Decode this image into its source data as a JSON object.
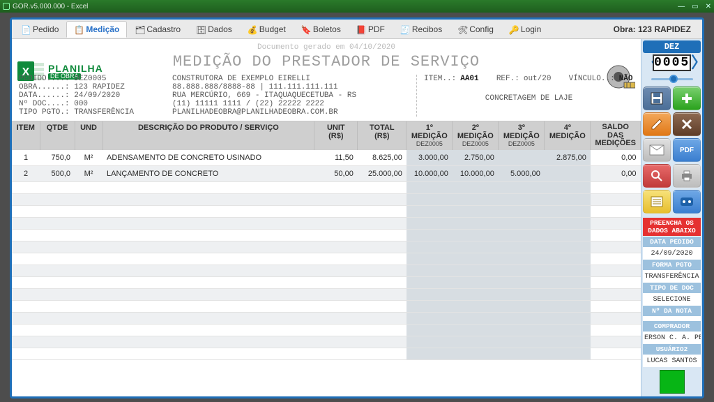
{
  "window": {
    "title": "GOR.v5.000.000 - Excel"
  },
  "menubar": {
    "items": [
      {
        "label": "Pedido"
      },
      {
        "label": "Medição"
      },
      {
        "label": "Cadastro"
      },
      {
        "label": "Dados"
      },
      {
        "label": "Budget"
      },
      {
        "label": "Boletos"
      },
      {
        "label": "PDF"
      },
      {
        "label": "Recibos"
      },
      {
        "label": "Config"
      },
      {
        "label": "Login"
      }
    ],
    "obra": "Obra: 123 RAPIDEZ"
  },
  "doc": {
    "generated": "Documento gerado em 04/10/2020",
    "title": "MEDIÇÃO DO PRESTADOR DE SERVIÇO",
    "brand1": "PLANILHA",
    "brand2": "DE OBRA",
    "left": "PEDIDO....: DEZ0005\nOBRA......: 123 RAPIDEZ\nDATA......: 24/09/2020\nNº DOC....: 000\nTIPO PGTO.: TRANSFERÊNCIA",
    "mid": "CONSTRUTORA DE EXEMPLO EIRELLI\n88.888.888/8888-88 | 111.111.111.111\nRUA MERCÚRIO, 669 - ITAQUAQUECETUBA - RS\n(11) 11111 1111 / (22) 22222 2222\nPLANILHADEOBRA@PLANILHADEOBRA.COM.BR",
    "right": {
      "item_l": "ITEM..:",
      "item_v": "AA01",
      "ref_l": "REF.:",
      "ref_v": "out/20",
      "vinc_l": "VÍNCULO..:",
      "vinc_v": "NÃO",
      "service": "CONCRETAGEM DE LAJE"
    }
  },
  "table": {
    "headers": {
      "item": "ITEM",
      "qtde": "QTDE",
      "und": "UND",
      "desc": "DESCRIÇÃO DO PRODUTO / SERVIÇO",
      "unit": "UNIT (R$)",
      "total": "TOTAL (R$)",
      "m1": "1º MEDIÇÃO",
      "m1s": "DEZ0005",
      "m2": "2º MEDIÇÃO",
      "m2s": "DEZ0005",
      "m3": "3º MEDIÇÃO",
      "m3s": "DEZ0005",
      "m4": "4º MEDIÇÃO",
      "m4s": "",
      "saldo": "SALDO DAS MEDIÇÕES"
    },
    "rows": [
      {
        "item": "1",
        "qtde": "750,0",
        "und": "M²",
        "desc": "ADENSAMENTO DE CONCRETO USINADO",
        "unit": "11,50",
        "total": "8.625,00",
        "m1": "3.000,00",
        "m2": "2.750,00",
        "m3": "",
        "m4": "2.875,00",
        "saldo": "0,00"
      },
      {
        "item": "2",
        "qtde": "500,0",
        "und": "M²",
        "desc": "LANÇAMENTO DE CONCRETO",
        "unit": "50,00",
        "total": "25.000,00",
        "m1": "10.000,00",
        "m2": "10.000,00",
        "m3": "5.000,00",
        "m4": "",
        "saldo": "0,00"
      }
    ]
  },
  "side": {
    "dez": "DEZ",
    "counter": "0005",
    "panels": [
      {
        "label": "PREENCHA OS DADOS ABAIXO",
        "value": null,
        "bg": "#e53131"
      },
      {
        "label": "DATA PEDIDO",
        "value": "24/09/2020",
        "bg": "#9cc1de"
      },
      {
        "label": "FORMA PGTO",
        "value": "TRANSFERÊNCIA",
        "bg": "#9cc1de"
      },
      {
        "label": "TIPO DE DOC",
        "value": "SELECIONE",
        "bg": "#9cc1de"
      },
      {
        "label": "Nº DA NOTA",
        "value": " ",
        "bg": "#9cc1de"
      },
      {
        "label": "COMPRADOR",
        "value": "ERSON C. A. PERE",
        "bg": "#9cc1de"
      },
      {
        "label": "USUÁRIO2",
        "value": "LUCAS SANTOS",
        "bg": "#9cc1de"
      }
    ]
  },
  "chart_data": {
    "type": "table",
    "columns": [
      "ITEM",
      "QTDE",
      "UND",
      "DESCRIÇÃO",
      "UNIT (R$)",
      "TOTAL (R$)",
      "1º MEDIÇÃO",
      "2º MEDIÇÃO",
      "3º MEDIÇÃO",
      "4º MEDIÇÃO",
      "SALDO"
    ],
    "rows": [
      [
        1,
        750.0,
        "M²",
        "ADENSAMENTO DE CONCRETO USINADO",
        11.5,
        8625.0,
        3000.0,
        2750.0,
        null,
        2875.0,
        0.0
      ],
      [
        2,
        500.0,
        "M²",
        "LANÇAMENTO DE CONCRETO",
        50.0,
        25000.0,
        10000.0,
        10000.0,
        5000.0,
        null,
        0.0
      ]
    ]
  }
}
